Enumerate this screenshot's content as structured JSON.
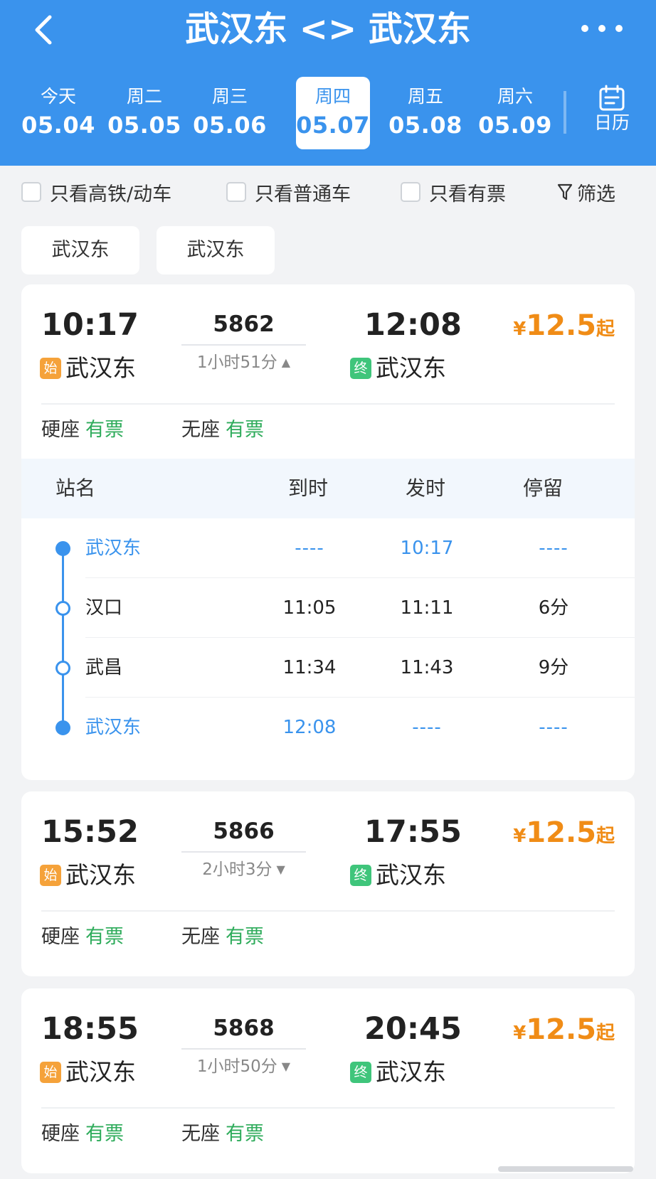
{
  "header": {
    "title": "武汉东 <> 武汉东",
    "bg_color": "#3a93ed",
    "dates": [
      {
        "weekday": "今天",
        "date": "05.04"
      },
      {
        "weekday": "周二",
        "date": "05.05"
      },
      {
        "weekday": "周三",
        "date": "05.06"
      },
      {
        "weekday": "周四",
        "date": "05.07",
        "selected": true
      },
      {
        "weekday": "周五",
        "date": "05.08"
      },
      {
        "weekday": "周六",
        "date": "05.09"
      }
    ],
    "calendar_label": "日历"
  },
  "filters": {
    "items": [
      {
        "label": "只看高铁/动车",
        "checked": false
      },
      {
        "label": "只看普通车",
        "checked": false
      },
      {
        "label": "只看有票",
        "checked": false
      }
    ],
    "filter_label": "筛选"
  },
  "stations": {
    "from": "武汉东",
    "to": "武汉东"
  },
  "trains": [
    {
      "dep_time": "10:17",
      "arr_time": "12:08",
      "train_no": "5862",
      "duration": "1小时51分",
      "expanded": true,
      "price_currency": "¥",
      "price": "12.5",
      "price_suffix": "起",
      "start_tag": "始",
      "end_tag": "终",
      "dep_station": "武汉东",
      "arr_station": "武汉东",
      "seats": [
        {
          "type": "硬座",
          "status": "有票"
        },
        {
          "type": "无座",
          "status": "有票"
        }
      ]
    },
    {
      "dep_time": "15:52",
      "arr_time": "17:55",
      "train_no": "5866",
      "duration": "2小时3分",
      "expanded": false,
      "price_currency": "¥",
      "price": "12.5",
      "price_suffix": "起",
      "start_tag": "始",
      "end_tag": "终",
      "dep_station": "武汉东",
      "arr_station": "武汉东",
      "seats": [
        {
          "type": "硬座",
          "status": "有票"
        },
        {
          "type": "无座",
          "status": "有票"
        }
      ]
    },
    {
      "dep_time": "18:55",
      "arr_time": "20:45",
      "train_no": "5868",
      "duration": "1小时50分",
      "expanded": false,
      "price_currency": "¥",
      "price": "12.5",
      "price_suffix": "起",
      "start_tag": "始",
      "end_tag": "终",
      "dep_station": "武汉东",
      "arr_station": "武汉东",
      "seats": [
        {
          "type": "硬座",
          "status": "有票"
        },
        {
          "type": "无座",
          "status": "有票"
        }
      ]
    }
  ],
  "stops": {
    "headers": [
      "站名",
      "到时",
      "发时",
      "停留"
    ],
    "rows": [
      {
        "name": "武汉东",
        "arrive": "----",
        "depart": "10:17",
        "stay": "----",
        "highlight": true
      },
      {
        "name": "汉口",
        "arrive": "11:05",
        "depart": "11:11",
        "stay": "6分",
        "highlight": false
      },
      {
        "name": "武昌",
        "arrive": "11:34",
        "depart": "11:43",
        "stay": "9分",
        "highlight": false
      },
      {
        "name": "武汉东",
        "arrive": "12:08",
        "depart": "----",
        "stay": "----",
        "highlight": true
      }
    ]
  },
  "icons": {
    "back": "chevron-left-icon",
    "more": "more-horizontal-icon",
    "calendar": "calendar-icon",
    "filter": "filter-icon",
    "expand": "triangle-up-icon",
    "collapse": "triangle-down-icon"
  },
  "colors": {
    "accent": "#3a93ed",
    "price": "#f08c16",
    "available": "#2dab5a",
    "start_tag": "#f5a23a",
    "end_tag": "#3fc57b"
  }
}
